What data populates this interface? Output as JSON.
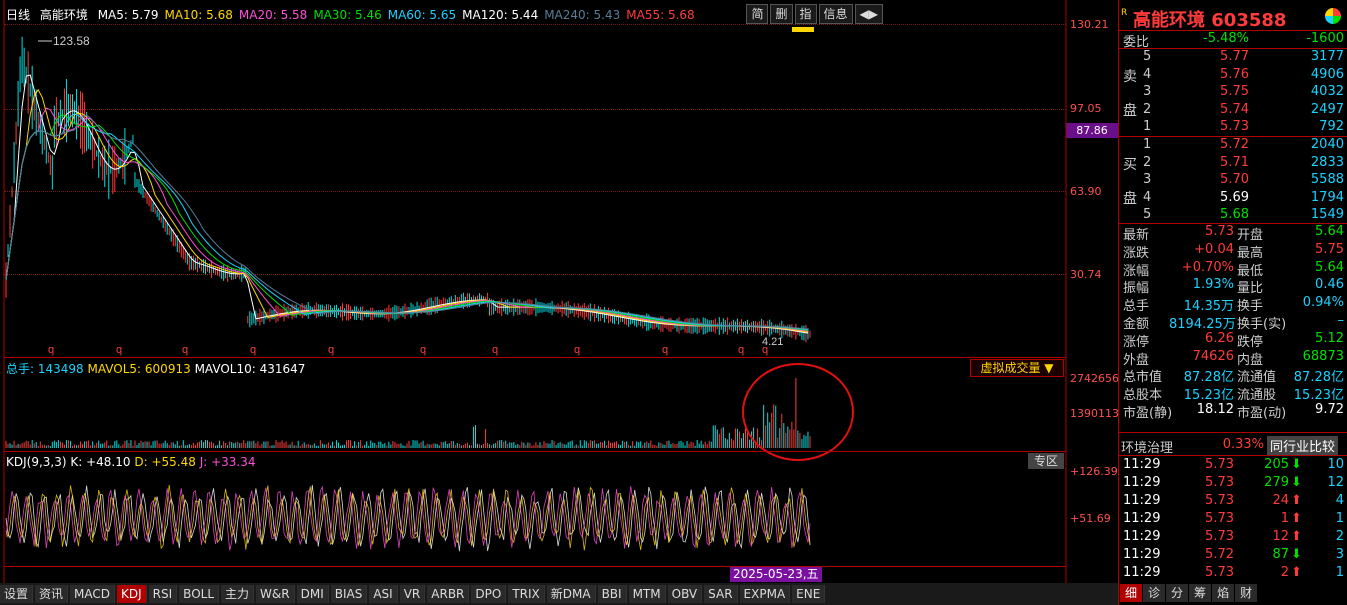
{
  "chart_header": {
    "period": "日线",
    "stock_name": "高能环境",
    "ma": [
      {
        "label": "MA5: 5.79",
        "color": "#ffffff"
      },
      {
        "label": "MA10: 5.68",
        "color": "#ffd700"
      },
      {
        "label": "MA20: 5.58",
        "color": "#ff4fd8"
      },
      {
        "label": "MA30: 5.46",
        "color": "#00e000"
      },
      {
        "label": "MA60: 5.65",
        "color": "#19d3ff"
      },
      {
        "label": "MA120: 5.44",
        "color": "#ffffff"
      },
      {
        "label": "MA240: 5.43",
        "color": "#5a7c9a"
      },
      {
        "label": "MA55: 5.68",
        "color": "#ff3b3b"
      }
    ]
  },
  "toolbar": [
    "简",
    "删",
    "指",
    "信息",
    "◀▶"
  ],
  "price_axis": [
    "130.21",
    "97.05",
    "63.90",
    "30.74"
  ],
  "price_marker": "87.86",
  "high_label": "123.58",
  "low_label": "4.21",
  "volume": {
    "legend_total_label": "总手: 143498",
    "legend_mavol5": "MAVOL5: 600913",
    "legend_mavol10": "MAVOL10: 431647",
    "axis": [
      "2742656",
      "1390113"
    ],
    "virtual_btn": "虚拟成交量 ▼"
  },
  "kdj": {
    "legend_name": "KDJ(9,3,3)",
    "legend_k": "K: +48.10",
    "legend_d": "D: +55.48",
    "legend_j": "J: +33.34",
    "axis": [
      "+126.39",
      "+51.69"
    ],
    "zone_btn": "专区"
  },
  "date_tag": "2025-05-23,五",
  "bottom_tabs": [
    "设置",
    "资讯",
    "MACD",
    "KDJ",
    "RSI",
    "BOLL",
    "主力",
    "W&R",
    "DMI",
    "BIAS",
    "ASI",
    "VR",
    "ARBR",
    "DPO",
    "TRIX",
    "新DMA",
    "BBI",
    "MTM",
    "OBV",
    "SAR",
    "EXPMA",
    "ENE"
  ],
  "bottom_tab_active": "KDJ",
  "side": {
    "title": "高能环境 603588",
    "weibi": {
      "label": "委比",
      "pct": "-5.48%",
      "diff": "-1600"
    },
    "sell": [
      {
        "lvl": "5",
        "price": "5.77",
        "vol": "3177"
      },
      {
        "lvl": "4",
        "price": "5.76",
        "vol": "4906"
      },
      {
        "lvl": "3",
        "price": "5.75",
        "vol": "4032"
      },
      {
        "lvl": "2",
        "price": "5.74",
        "vol": "2497"
      },
      {
        "lvl": "1",
        "price": "5.73",
        "vol": "792"
      }
    ],
    "buy": [
      {
        "lvl": "1",
        "price": "5.72",
        "vol": "2040"
      },
      {
        "lvl": "2",
        "price": "5.71",
        "vol": "2833"
      },
      {
        "lvl": "3",
        "price": "5.70",
        "vol": "5588"
      },
      {
        "lvl": "4",
        "price": "5.69",
        "vol": "1794"
      },
      {
        "lvl": "5",
        "price": "5.68",
        "vol": "1549"
      }
    ],
    "sell_label_1": "卖",
    "sell_label_2": "盘",
    "buy_label_1": "买",
    "buy_label_2": "盘",
    "stats": [
      [
        "最新",
        "5.73",
        "开盘",
        "5.64"
      ],
      [
        "涨跌",
        "+0.04",
        "最高",
        "5.75"
      ],
      [
        "涨幅",
        "+0.70%",
        "最低",
        "5.64"
      ],
      [
        "振幅",
        "1.93%",
        "量比",
        "0.46"
      ],
      [
        "总手",
        "14.35万",
        "换手",
        "0.94%"
      ],
      [
        "金额",
        "8194.25万",
        "换手(实)",
        "–"
      ],
      [
        "涨停",
        "6.26",
        "跌停",
        "5.12"
      ],
      [
        "外盘",
        "74626",
        "内盘",
        "68873"
      ],
      [
        "总市值",
        "87.28亿",
        "流通值",
        "87.28亿"
      ],
      [
        "总股本",
        "15.23亿",
        "流通股",
        "15.23亿"
      ],
      [
        "市盈(静)",
        "18.12",
        "市盈(动)",
        "9.72"
      ]
    ],
    "sector": {
      "name": "环境治理",
      "pct": "0.33%",
      "btn": "同行业比较"
    },
    "ticks": [
      {
        "time": "11:29",
        "price": "5.73",
        "vol": "205",
        "dir": "down",
        "n": "10"
      },
      {
        "time": "11:29",
        "price": "5.73",
        "vol": "279",
        "dir": "down",
        "n": "12"
      },
      {
        "time": "11:29",
        "price": "5.73",
        "vol": "24",
        "dir": "up",
        "n": "4"
      },
      {
        "time": "11:29",
        "price": "5.73",
        "vol": "1",
        "dir": "up",
        "n": "1"
      },
      {
        "time": "11:29",
        "price": "5.73",
        "vol": "12",
        "dir": "up",
        "n": "2"
      },
      {
        "time": "11:29",
        "price": "5.72",
        "vol": "87",
        "dir": "down",
        "n": "3"
      },
      {
        "time": "11:29",
        "price": "5.73",
        "vol": "2",
        "dir": "up",
        "n": "1"
      }
    ],
    "tabs": [
      "细",
      "诊",
      "分",
      "筹",
      "焰",
      "财"
    ],
    "tab_active": "细"
  }
}
